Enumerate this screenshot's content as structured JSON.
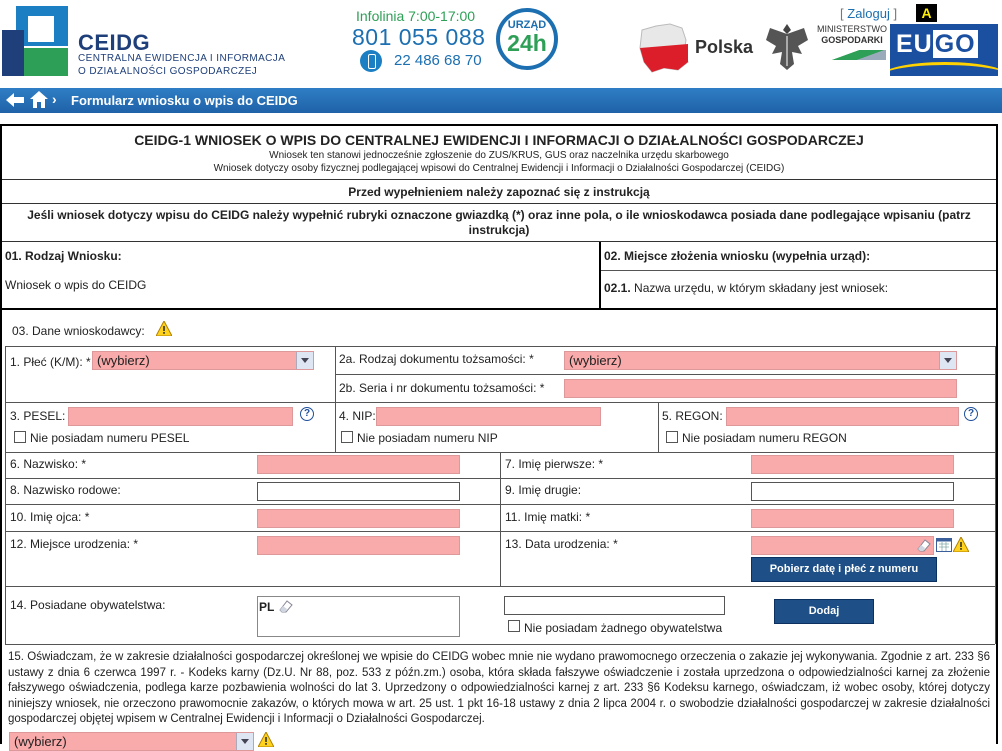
{
  "header": {
    "logo_title": "CEIDG",
    "logo_sub1": "CENTRALNA EWIDENCJA I INFORMACJA",
    "logo_sub2": "O DZIAŁALNOŚCI GOSPODARCZEJ",
    "infolinia_label": "Infolinia 7:00-17:00",
    "infolinia_phone": "801 055 088",
    "infolinia_phone2": "22 486 68 70",
    "badge_top": "URZĄD",
    "badge_bottom": "24h",
    "country": "Polska",
    "ministry_l1": "MINISTERSTWO",
    "ministry_l2": "GOSPODARKI",
    "login_open": "[",
    "login_label": "Zaloguj",
    "login_close": "]",
    "contrast_label": "A",
    "eugo_a": "EU",
    "eugo_b": "GO"
  },
  "navbar": {
    "title": "Formularz wniosku o wpis do CEIDG",
    "chevron": "›"
  },
  "form": {
    "title": "CEIDG-1 WNIOSEK O WPIS DO CENTRALNEJ EWIDENCJI I INFORMACJI O DZIAŁALNOŚCI GOSPODARCZEJ",
    "subtitle1": "Wniosek ten stanowi jednocześnie zgłoszenie do ZUS/KRUS, GUS oraz naczelnika urzędu skarbowego",
    "subtitle2": "Wniosek dotyczy osoby fizycznej podlegającej wpisowi do Centralnej Ewidencji i Informacji o Działalności Gospodarczej (CEIDG)",
    "instruction_title": "Przed wypełnieniem należy zapoznać się z instrukcją",
    "instruction_text1": "Jeśli wniosek dotyczy wpisu do CEIDG należy wypełnić rubryki oznaczone gwiazdką (*) oraz inne pola, o ile wnioskodawca posiada dane podlegające wpisaniu (patrz",
    "instruction_text2": "instrukcja)",
    "s01_label": "01. Rodzaj Wniosku:",
    "s01_value": "Wniosek o wpis do CEIDG",
    "s02_label": "02. Miejsce złożenia wniosku (wypełnia urząd):",
    "s021_num": "02.1.",
    "s021_label": "Nazwa urzędu, w którym składany jest wniosek:",
    "s03_label": "03. Dane wnioskodawcy:",
    "f1_label": "1. Płeć (K/M): *",
    "f1_value": "(wybierz)",
    "f2a_label": "2a. Rodzaj dokumentu tożsamości: *",
    "f2a_value": "(wybierz)",
    "f2b_label": "2b. Seria i nr dokumentu tożsamości: *",
    "f3_label": "3. PESEL:",
    "f3_help": "?",
    "f3_chk": "Nie posiadam numeru PESEL",
    "f4_label": "4. NIP:",
    "f4_chk": "Nie posiadam numeru NIP",
    "f5_label": "5. REGON:",
    "f5_help": "?",
    "f5_chk": "Nie posiadam numeru REGON",
    "f6_label": "6. Nazwisko: *",
    "f7_label": "7. Imię pierwsze: *",
    "f8_label": "8. Nazwisko rodowe:",
    "f9_label": "9. Imię drugie:",
    "f10_label": "10. Imię ojca: *",
    "f11_label": "11. Imię matki: *",
    "f12_label": "12. Miejsce urodzenia: *",
    "f13_label": "13. Data urodzenia: *",
    "f13_button": "Pobierz datę i płeć z numeru PESEL",
    "f14_label": "14. Posiadane obywatelstwa:",
    "f14_value": "PL",
    "f14_add": "Dodaj",
    "f14_chk": "Nie posiadam żadnego obywatelstwa",
    "f15_text": "15. Oświadczam, że w zakresie działalności gospodarczej określonej we wpisie do CEIDG wobec mnie nie wydano prawomocnego orzeczenia o zakazie jej wykonywania. Zgodnie z art. 233 §6 ustawy z dnia 6 czerwca 1997 r. - Kodeks karny (Dz.U. Nr 88, poz. 533 z późn.zm.) osoba, która składa fałszywe oświadczenie i została uprzedzona o odpowiedzialności karnej za złożenie fałszywego oświadczenia, podlega karze pozbawienia wolności do lat 3. Uprzedzony o odpowiedzialności karnej z art. 233 §6 Kodeksu karnego, oświadczam, iż wobec osoby, której dotyczy niniejszy wniosek, nie orzeczono prawomocnie zakazów, o których mowa w art. 25 ust. 1 pkt 16-18 ustawy z dnia 2 lipca 2004 r. o swobodzie działalności gospodarczej w zakresie działalności gospodarczej objętej wpisem w Centralnej Ewidencji i Informacji o Działalności Gospodarczej.",
    "f15_value": "(wybierz)"
  },
  "colors": {
    "required_field": "#f9aaaa",
    "nav_bar": "#2f7ec5",
    "brand_blue": "#1c6fb0",
    "brand_green": "#2e9f56"
  }
}
